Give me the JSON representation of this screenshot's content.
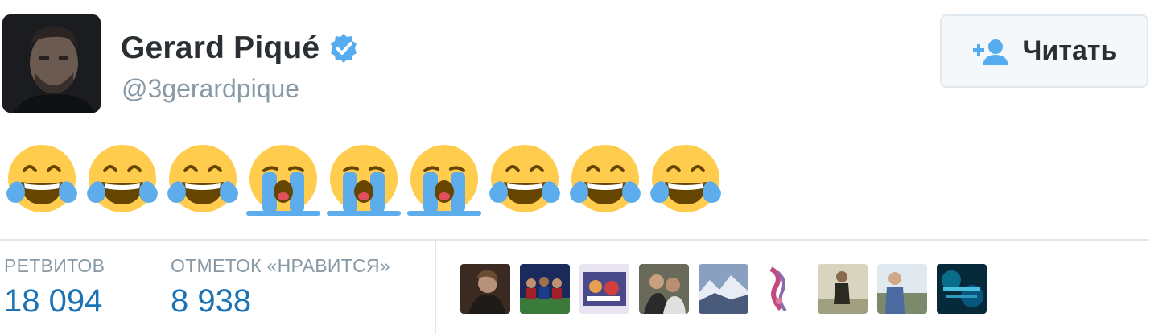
{
  "user": {
    "name": "Gerard Piqué",
    "handle": "@3gerardpique",
    "verified": true,
    "avatar_icon": "user-photo"
  },
  "follow_button": {
    "label": "Читать",
    "icon": "add-user-icon",
    "accent": "#55acee"
  },
  "tweet": {
    "emojis": [
      "face-with-tears-of-joy",
      "face-with-tears-of-joy",
      "face-with-tears-of-joy",
      "loudly-crying-face",
      "loudly-crying-face",
      "loudly-crying-face",
      "face-with-tears-of-joy",
      "face-with-tears-of-joy",
      "face-with-tears-of-joy"
    ]
  },
  "stats": {
    "retweets": {
      "label": "РЕТВИТОВ",
      "value": "18 094"
    },
    "likes": {
      "label": "ОТМЕТОК «НРАВИТСЯ»",
      "value": "8 938"
    }
  },
  "likers": {
    "count": 9,
    "thumbnail_colors": [
      "#3a2a22",
      "#2a3a7a",
      "#5a5a8a",
      "#4a4a3a",
      "#6a7a9a",
      "#c9a0b8",
      "#b8b8a0",
      "#6a7aa0",
      "#0a6a8a"
    ]
  },
  "colors": {
    "stat_value": "#1b73b5",
    "muted": "#8899a6",
    "verified": "#55acee",
    "emoji_yellow": "#ffcc4d",
    "tear_blue": "#5dadec"
  }
}
